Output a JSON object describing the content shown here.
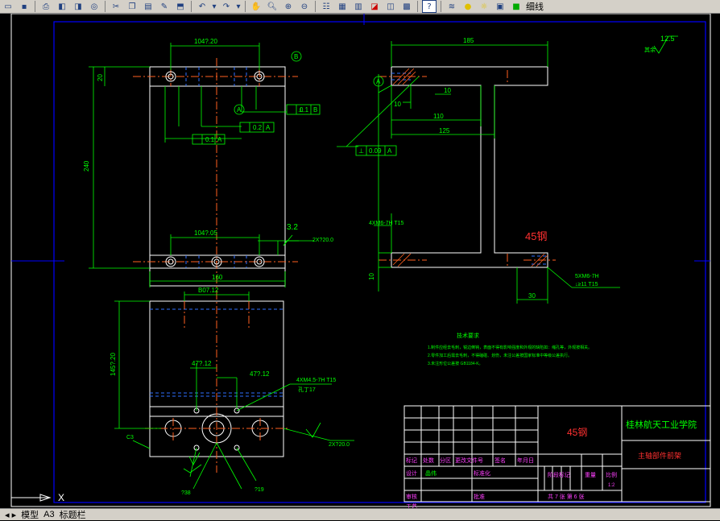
{
  "toolbar": {
    "icons": [
      "folder-open-icon",
      "save-icon",
      "print-icon",
      "print-preview-icon",
      "plot-icon",
      "cut-icon",
      "copy-icon",
      "paste-icon",
      "match-properties-icon",
      "paint-icon",
      "undo-icon",
      "redo-icon",
      "pan-icon",
      "zoom-realtime-icon",
      "zoom-window-icon",
      "zoom-previous-icon",
      "properties-icon",
      "design-center-icon",
      "tool-palette-icon",
      "sheet-set-icon",
      "calculator-icon",
      "help-icon",
      "layer-icon",
      "lineweight-icon"
    ],
    "lineweight_label": "细线"
  },
  "status": {
    "tabs": [
      "模型",
      "A3",
      "标题栏"
    ]
  },
  "ucs_label": "X",
  "drawing": {
    "front": {
      "dim_top": "104?.20",
      "dim_bottom": "104?.05",
      "dim_height": "240",
      "dim_20": "20",
      "dim_width": "160",
      "tol_par_b": "0.1",
      "datum_b_ref": "B",
      "tol_par_a1": "0.2",
      "datum_a_ref1": "A",
      "tol_par_a2": "0.1",
      "datum_a_ref2": "A",
      "datum_b": "B",
      "datum_a": "A",
      "rough": "3.2",
      "hole_callout": "2X?20.0"
    },
    "side": {
      "dim_185": "185",
      "dim_10a": "10",
      "dim_10b": "10",
      "dim_110": "110",
      "dim_125": "125",
      "tol_perp": "0.09",
      "tol_perp_ref": "A",
      "datum_a": "A",
      "thread_left": "4XM6-7H T15",
      "dim_10c": "10",
      "dim_30": "30",
      "thread_right_1": "5XM6-7H",
      "thread_right_2": "↓≥11 T15",
      "material_red": "45钢"
    },
    "bottom": {
      "dim_top": "B07.12",
      "dim_left": "145?.20",
      "dim_a": "47?.12",
      "dim_b": "47?.12",
      "thread": "4XM4.5-7H T15",
      "thread2": "孔丁17",
      "c3": "C3",
      "hole_callout": "2X?20.0",
      "d38": "?38",
      "d19": "?19"
    },
    "roughness_corner": "12.5",
    "roughness_corner_note": "其余",
    "tech": {
      "title": "技术要求",
      "lines": [
        "1.制件应经去毛刺，锐边倒钝，表面不得有影响强度和外观的缺陷如：缩孔等，外观按相关。",
        "2.零件加工后需去毛刺，不得磕碰、划伤，未注公差按国家标准中等级公差执行。",
        "3.未注形位公差按 GB1184-K。"
      ]
    }
  },
  "title_block": {
    "material": "45钢",
    "school": "桂林航天工业学院",
    "part_name": "主轴部件前架",
    "labels": {
      "mark": "标记",
      "count": "处数",
      "zone": "分区",
      "change_doc": "更改文件号",
      "sign": "签名",
      "date": "年月日",
      "design": "设计",
      "designer": "晶伟",
      "standard": "标准化",
      "stage_mark": "阶段标记",
      "weight": "重量",
      "scale": "比例",
      "scale_value": "1:2",
      "review": "审核",
      "process": "工艺",
      "approve": "批准",
      "sheets": "共 7 张  第 6 张"
    }
  }
}
